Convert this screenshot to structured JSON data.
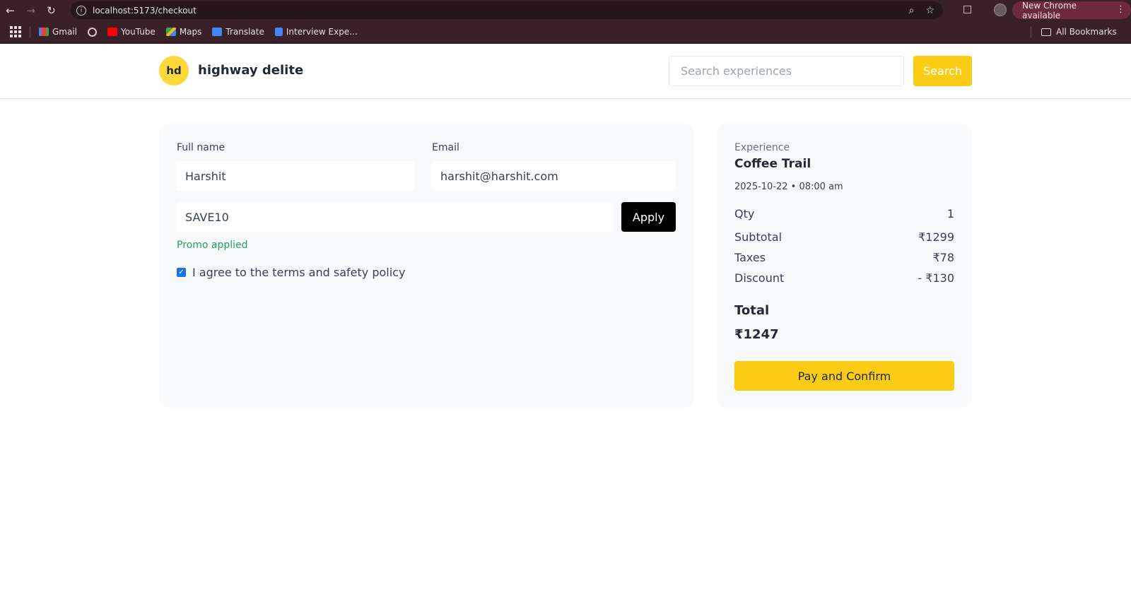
{
  "browser": {
    "url": "localhost:5173/checkout",
    "update_label": "New Chrome available",
    "bookmarks": [
      "Gmail",
      "YouTube",
      "Maps",
      "Translate",
      "Interview Expe..."
    ],
    "all_bookmarks_label": "All Bookmarks"
  },
  "header": {
    "logo_text": "hd",
    "brand": "highway delite",
    "search_placeholder": "Search experiences",
    "search_label": "Search"
  },
  "form": {
    "full_name_label": "Full name",
    "full_name_value": "Harshit",
    "email_label": "Email",
    "email_value": "harshit@harshit.com",
    "promo_value": "SAVE10",
    "apply_label": "Apply",
    "promo_status": "Promo applied",
    "agree_label": "I agree to the terms and safety policy",
    "agree_checked": true
  },
  "summary": {
    "experience_label": "Experience",
    "experience_name": "Coffee Trail",
    "datetime": "2025-10-22 • 08:00 am",
    "qty_label": "Qty",
    "qty_value": "1",
    "subtotal_label": "Subtotal",
    "subtotal_value": "₹1299",
    "taxes_label": "Taxes",
    "taxes_value": "₹78",
    "discount_label": "Discount",
    "discount_value": "- ₹130",
    "total_label": "Total",
    "total_value": "₹1247",
    "pay_label": "Pay and Confirm"
  },
  "colors": {
    "accent": "#facc15",
    "success": "#22a05a",
    "chrome": "#3a2028"
  }
}
